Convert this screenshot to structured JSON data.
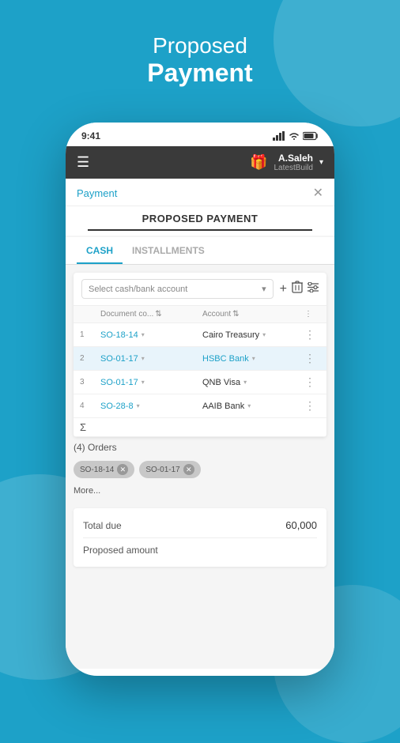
{
  "page": {
    "header": {
      "proposed": "Proposed",
      "payment": "Payment"
    }
  },
  "phone": {
    "status_bar": {
      "time": "9:41",
      "signal": "●●●",
      "wifi": "wifi",
      "battery": "battery"
    },
    "app_header": {
      "hamburger": "☰",
      "gift_icon": "🎁",
      "user_name": "A.Saleh",
      "user_sub": "LatestBuild",
      "chevron": "▾"
    },
    "payment_nav": {
      "link": "Payment",
      "close": "✕"
    },
    "proposed_title": "PROPOSED PAYMENT",
    "tabs": [
      {
        "label": "CASH",
        "active": true
      },
      {
        "label": "INSTALLMENTS",
        "active": false
      }
    ],
    "toolbar": {
      "select_placeholder": "Select cash/bank account",
      "plus_icon": "+",
      "delete_icon": "🗑",
      "filter_icon": "☰"
    },
    "table": {
      "headers": [
        {
          "label": ""
        },
        {
          "label": "Document co..."
        },
        {
          "label": "Account"
        },
        {
          "label": "⋮"
        }
      ],
      "rows": [
        {
          "num": "1",
          "doc": "SO-18-14",
          "account": "Cairo Treasury",
          "highlighted": false
        },
        {
          "num": "2",
          "doc": "SO-01-17",
          "account": "HSBC Bank",
          "highlighted": true
        },
        {
          "num": "3",
          "doc": "SO-01-17",
          "account": "QNB Visa",
          "highlighted": false
        },
        {
          "num": "4",
          "doc": "SO-28-8",
          "account": "AAIB Bank",
          "highlighted": false
        }
      ],
      "sigma": "Σ"
    },
    "orders": {
      "label": "(4) Orders"
    },
    "tags": [
      {
        "label": "SO-18-14"
      },
      {
        "label": "SO-01-17"
      }
    ],
    "more": "More...",
    "totals": {
      "total_due_label": "Total due",
      "total_due_value": "60,000",
      "proposed_label": "Proposed amount"
    },
    "tooltip": {
      "account_label": "Account",
      "account_value": "Cairo Treasury"
    }
  }
}
